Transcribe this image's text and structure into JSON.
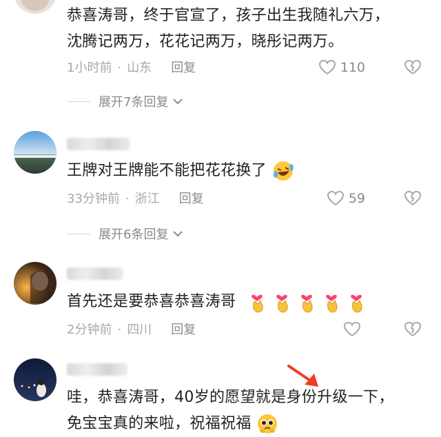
{
  "comments": [
    {
      "text_line1": "恭喜涛哥，终于官宣了，孩子出生我随礼六万，",
      "text_line2": "沈腾记两万，花花记两万，晓彤记两万。",
      "time": "1小时前",
      "location": "山东",
      "reply_label": "回复",
      "likes": "110",
      "expand_label": "展开7条回复"
    },
    {
      "text": "王牌对王牌能不能把花花换了",
      "time": "33分钟前",
      "location": "浙江",
      "reply_label": "回复",
      "likes": "59",
      "expand_label": "展开6条回复"
    },
    {
      "text": "首先还是要恭喜恭喜涛哥",
      "time": "2分钟前",
      "location": "四川",
      "reply_label": "回复"
    },
    {
      "text_line1": "哇，恭喜涛哥，40岁的愿望就是身份升级一下，",
      "text_line2": "免宝宝真的来啦，祝福祝福"
    }
  ],
  "icons": {
    "like": "heart-outline-icon",
    "dislike": "broken-heart-icon",
    "expand": "chevron-down-icon",
    "annotation": "red-arrow"
  },
  "colors": {
    "accent_red": "#f03c22",
    "meta_gray": "#a8a8a8"
  }
}
